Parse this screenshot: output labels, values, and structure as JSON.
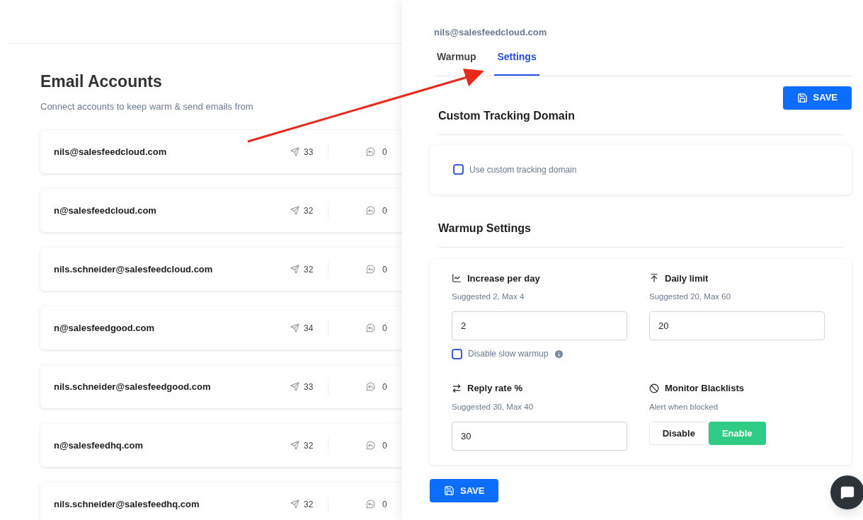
{
  "accounts_page": {
    "title": "Email Accounts",
    "subtitle": "Connect accounts to keep warm & send emails from",
    "accounts": [
      {
        "email": "nils@salesfeedcloud.com",
        "sent": "33",
        "replies": "0"
      },
      {
        "email": "n@salesfeedcloud.com",
        "sent": "32",
        "replies": "0"
      },
      {
        "email": "nils.schneider@salesfeedcloud.com",
        "sent": "32",
        "replies": "0"
      },
      {
        "email": "n@salesfeedgood.com",
        "sent": "34",
        "replies": "0"
      },
      {
        "email": "nils.schneider@salesfeedgood.com",
        "sent": "33",
        "replies": "0"
      },
      {
        "email": "n@salesfeedhq.com",
        "sent": "32",
        "replies": "0"
      },
      {
        "email": "nils.schneider@salesfeedhq.com",
        "sent": "32",
        "replies": "0"
      }
    ]
  },
  "drawer": {
    "account": "nils@salesfeedcloud.com",
    "tabs": [
      {
        "label": "Warmup",
        "selected": false
      },
      {
        "label": "Settings",
        "selected": true
      }
    ],
    "save_button": "SAVE",
    "tracking": {
      "title": "Custom Tracking Domain",
      "checkbox": {
        "label": "Use custom tracking domain",
        "checked": false
      }
    },
    "warmup": {
      "title": "Warmup Settings",
      "fields": [
        {
          "kind": "input",
          "label": "Increase per day",
          "hint": "Suggested 2, Max 4",
          "value": "2",
          "checkbox": {
            "label": "Disable slow warmup",
            "checked": false
          }
        },
        {
          "kind": "input",
          "label": "Daily limit",
          "hint": "Suggested 20, Max 60",
          "value": "20"
        },
        {
          "kind": "input",
          "label": "Reply rate %",
          "hint": "Suggested 30, Max 40",
          "value": "30"
        },
        {
          "kind": "toggle",
          "label": "Monitor Blacklists",
          "hint": "Alert when blocked",
          "options": [
            {
              "label": "Disable",
              "selected": false
            },
            {
              "label": "Enable",
              "selected": true
            }
          ]
        }
      ]
    },
    "bottom_save_button": "SAVE"
  }
}
